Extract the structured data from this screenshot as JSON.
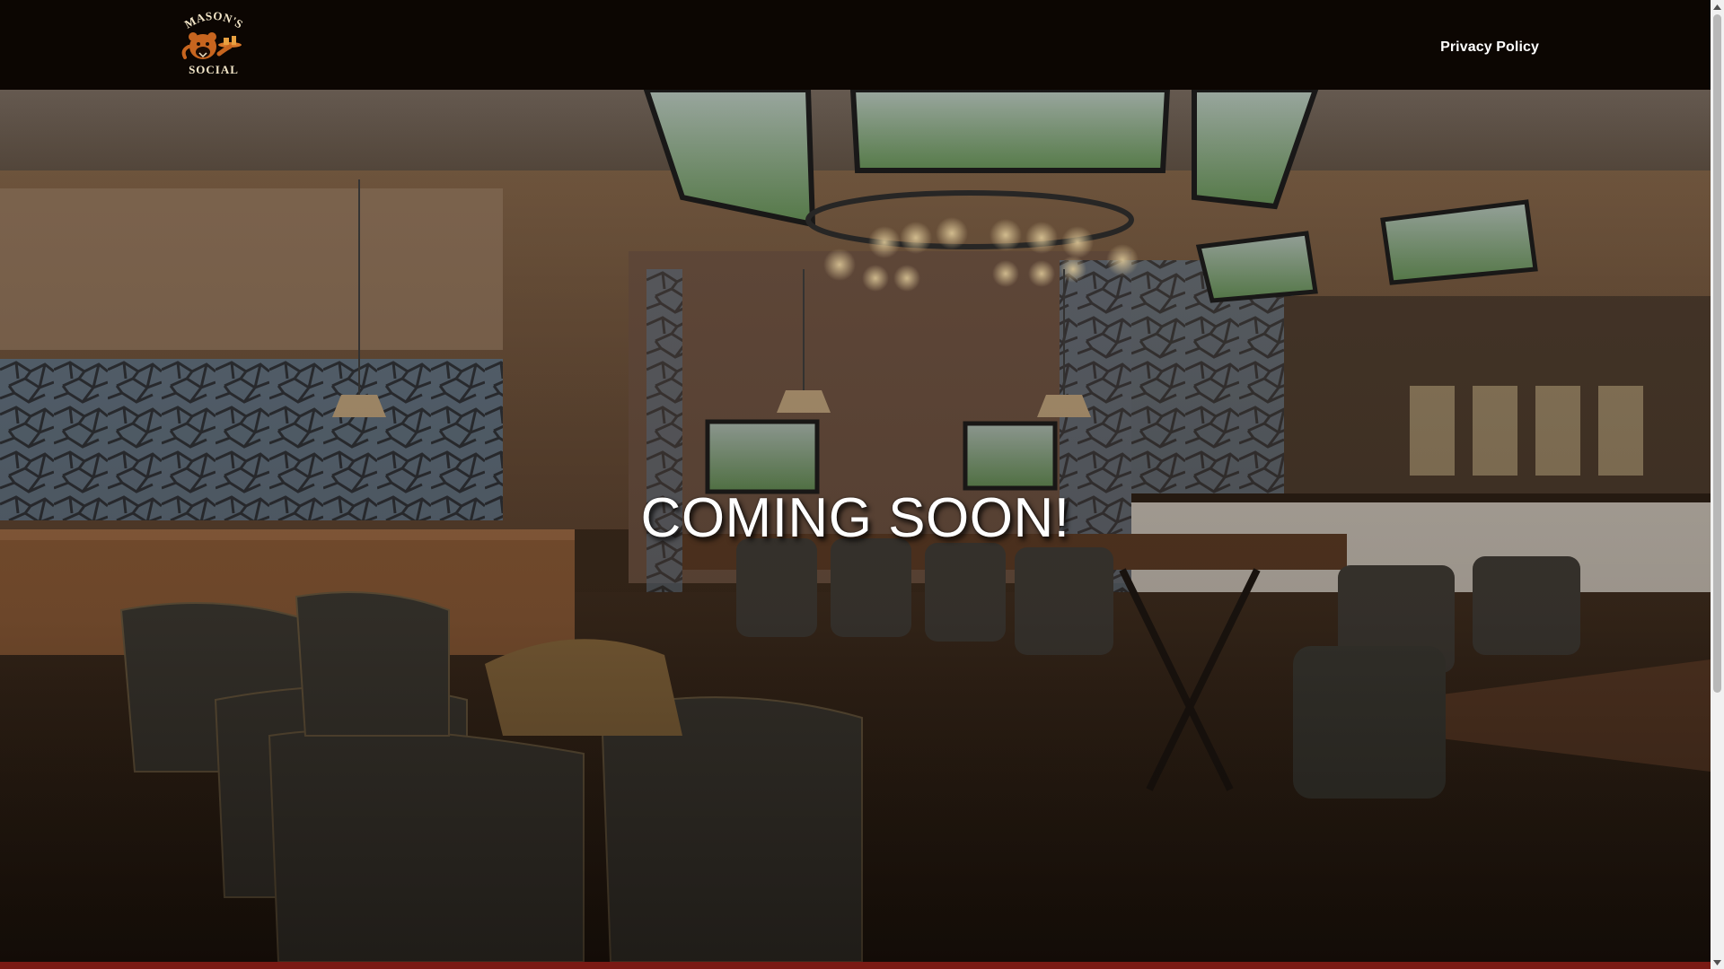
{
  "header": {
    "logo": {
      "name": "Mason's Social logo",
      "text_top": "MASON'S",
      "text_bottom": "SOCIAL"
    },
    "nav": {
      "privacy_label": "Privacy Policy"
    }
  },
  "hero": {
    "title": "COMING SOON!",
    "background": "sports-bar-interior"
  },
  "icons": {
    "scroll_up": "triangle-up-icon",
    "scroll_down": "triangle-down-icon"
  },
  "colors": {
    "header_bg": "#0c0602",
    "logo_orange": "#d9782a",
    "logo_cream": "#f3e6c8",
    "accent_red": "#7a1a14",
    "title_text": "#ffffff"
  }
}
